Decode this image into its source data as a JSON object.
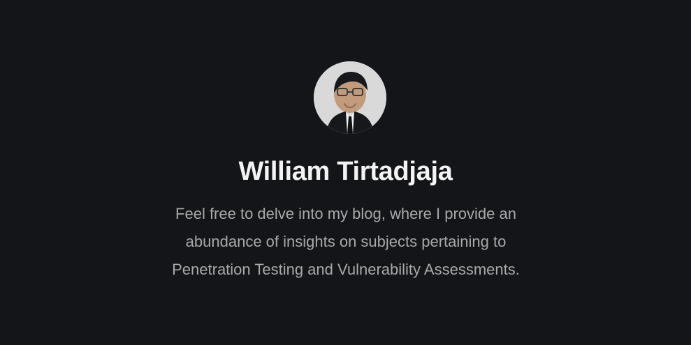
{
  "profile": {
    "name": "William Tirtadjaja",
    "bio": "Feel free to delve into my blog, where I provide an abundance of insights on subjects pertaining to Penetration Testing and Vulnerability Assessments.",
    "avatar_icon": "profile-photo-icon"
  },
  "colors": {
    "background": "#141518",
    "name_text": "#f3f3f3",
    "bio_text": "#a9a9a9"
  }
}
